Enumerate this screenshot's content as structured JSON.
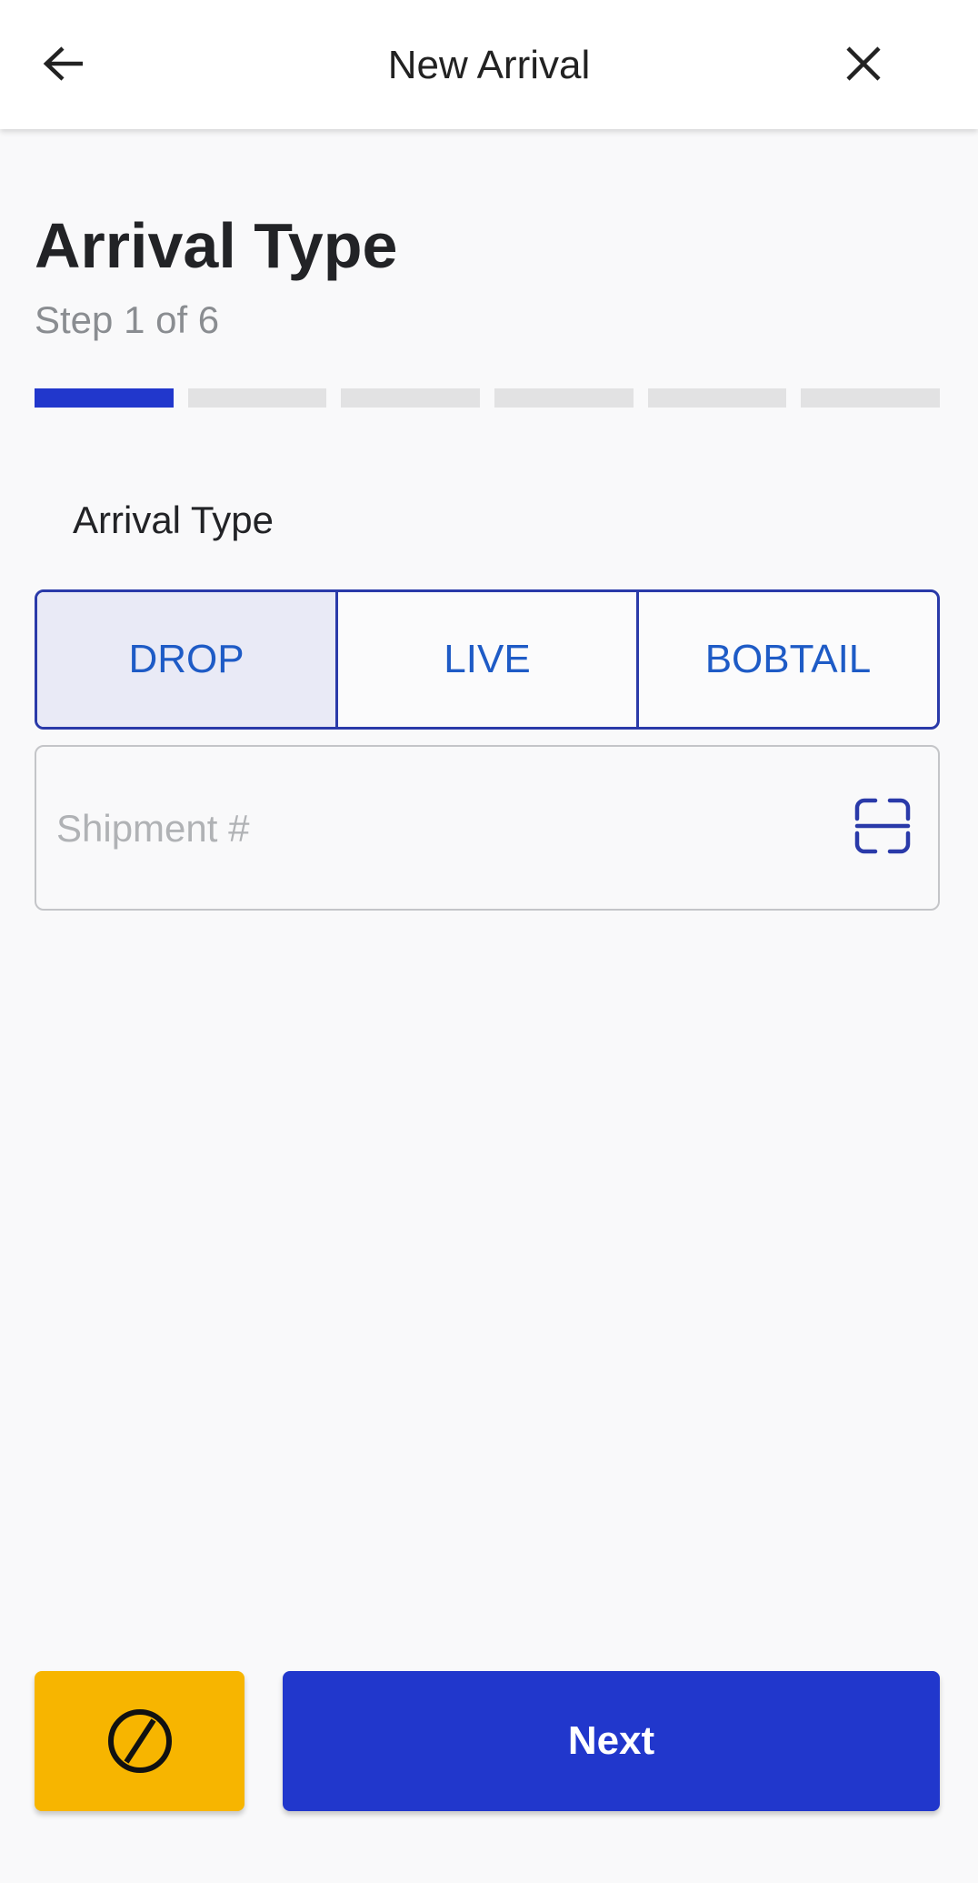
{
  "appbar": {
    "title": "New Arrival",
    "back_icon": "arrow-left-icon",
    "close_icon": "close-icon"
  },
  "page": {
    "heading": "Arrival Type",
    "step_text": "Step 1 of 6",
    "progress": {
      "current_step": 1,
      "total_steps": 6
    }
  },
  "form": {
    "arrival_type_label": "Arrival Type",
    "arrival_type_options": [
      {
        "label": "DROP",
        "selected": true
      },
      {
        "label": "LIVE",
        "selected": false
      },
      {
        "label": "BOBTAIL",
        "selected": false
      }
    ],
    "shipment": {
      "value": "",
      "placeholder": "Shipment #",
      "scan_icon": "barcode-scan-icon"
    }
  },
  "footer": {
    "cancel_icon": "cancel-block-icon",
    "next_label": "Next"
  },
  "colors": {
    "primary": "#2137cc",
    "outline": "#2a3aa9",
    "option_text": "#1e5bc6",
    "selected_bg": "#e9eaf6",
    "cancel": "#f7b500",
    "progress_inactive": "#e2e2e3"
  }
}
